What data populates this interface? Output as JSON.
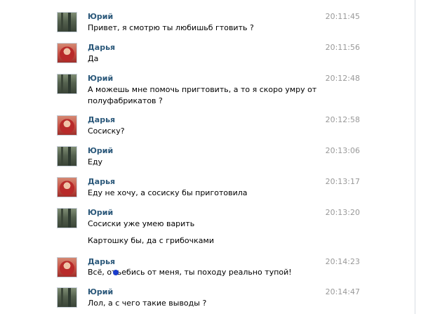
{
  "messages": [
    {
      "author": "Юрий",
      "avatar": "yuri",
      "time": "20:11:45",
      "lines": [
        "Привет, я смотрю ты любишьб гтовить ?"
      ]
    },
    {
      "author": "Дарья",
      "avatar": "darya",
      "time": "20:11:56",
      "lines": [
        "Да"
      ]
    },
    {
      "author": "Юрий",
      "avatar": "yuri",
      "time": "20:12:48",
      "lines": [
        "А можешь мне помочь пригтовить, а то я скоро умру от",
        "полуфабрикатов ?"
      ]
    },
    {
      "author": "Дарья",
      "avatar": "darya",
      "time": "20:12:58",
      "lines": [
        "Сосиску?"
      ]
    },
    {
      "author": "Юрий",
      "avatar": "yuri",
      "time": "20:13:06",
      "lines": [
        "Еду"
      ]
    },
    {
      "author": "Дарья",
      "avatar": "darya",
      "time": "20:13:17",
      "lines": [
        "Еду не хочу, а сосиску бы приготовила"
      ]
    },
    {
      "author": "Юрий",
      "avatar": "yuri",
      "time": "20:13:20",
      "lines": [
        "Сосиски уже умею варить",
        "",
        "Картошку бы, да с грибочками"
      ]
    },
    {
      "author": "Дарья",
      "avatar": "darya",
      "time": "20:14:23",
      "lines": [
        "Всё, отъебись от меня, ты походу реально тупой!"
      ]
    },
    {
      "author": "Юрий",
      "avatar": "yuri",
      "time": "20:14:47",
      "lines": [
        "Лол, а с чего такие выводы ?"
      ]
    }
  ],
  "colors": {
    "author": "#2b587a",
    "time": "#999999",
    "text": "#000000",
    "cursor": "#1a3ccc"
  }
}
